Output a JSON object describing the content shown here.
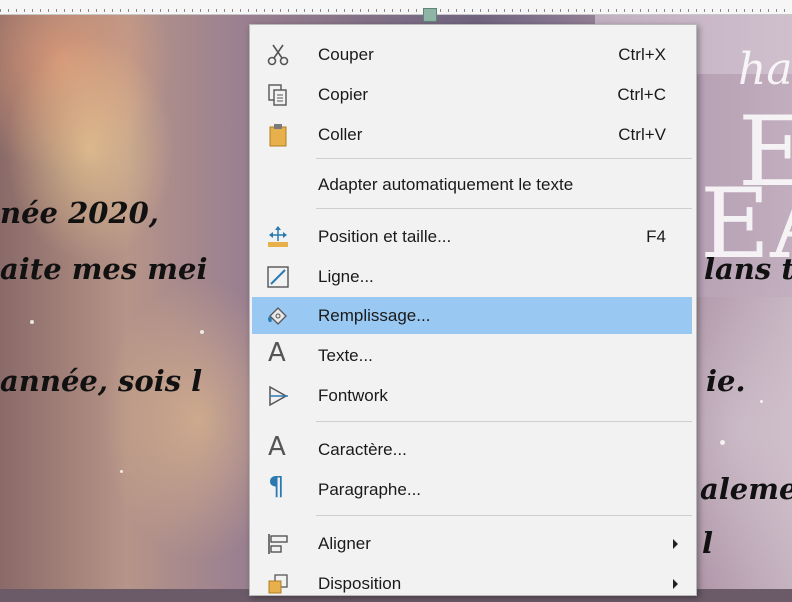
{
  "document": {
    "lines": [
      "née 2020,",
      "aite mes mei",
      "année, sois l",
      "lans t",
      "ie.",
      "aleme",
      "l"
    ],
    "bg_letters": [
      "ha",
      "E",
      "EA"
    ]
  },
  "menu": {
    "items": [
      {
        "label": "Couper",
        "shortcut": "Ctrl+X",
        "icon": "scissors-icon"
      },
      {
        "label": "Copier",
        "shortcut": "Ctrl+C",
        "icon": "copy-icon"
      },
      {
        "label": "Coller",
        "shortcut": "Ctrl+V",
        "icon": "paste-icon"
      },
      {
        "label": "Adapter automatiquement le texte",
        "shortcut": "",
        "icon": ""
      },
      {
        "label": "Position et taille...",
        "shortcut": "F4",
        "icon": "position-size-icon"
      },
      {
        "label": "Ligne...",
        "shortcut": "",
        "icon": "line-icon"
      },
      {
        "label": "Remplissage...",
        "shortcut": "",
        "icon": "fill-bucket-icon"
      },
      {
        "label": "Texte...",
        "shortcut": "",
        "icon": "text-icon"
      },
      {
        "label": "Fontwork",
        "shortcut": "",
        "icon": "fontwork-icon"
      },
      {
        "label": "Caractère...",
        "shortcut": "",
        "icon": "character-icon"
      },
      {
        "label": "Paragraphe...",
        "shortcut": "",
        "icon": "paragraph-icon"
      },
      {
        "label": "Aligner",
        "shortcut": "",
        "icon": "align-icon"
      },
      {
        "label": "Disposition",
        "shortcut": "",
        "icon": "arrange-icon"
      }
    ],
    "highlighted_index": 6,
    "highlight_color": "#99c9f3"
  }
}
